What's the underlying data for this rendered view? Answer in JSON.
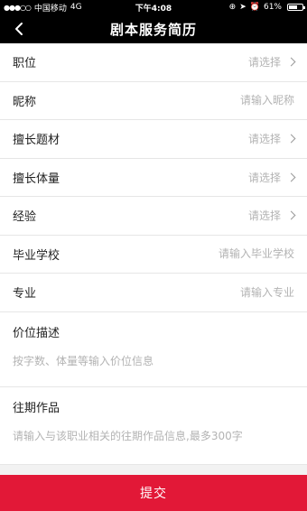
{
  "status_bar": {
    "signal": "●●●○○",
    "carrier": "中国移动",
    "network": "4G",
    "time": "下午4:08",
    "battery": "61%",
    "battery_level": 0.61
  },
  "nav": {
    "back_icon": "chevron-left-icon",
    "title": "剧本服务简历"
  },
  "form": {
    "position": {
      "label": "职位",
      "placeholder": "请选择"
    },
    "nickname": {
      "label": "昵称",
      "placeholder": "请输入昵称"
    },
    "theme": {
      "label": "擅长题材",
      "placeholder": "请选择"
    },
    "volume": {
      "label": "擅长体量",
      "placeholder": "请选择"
    },
    "experience": {
      "label": "经验",
      "placeholder": "请选择"
    },
    "school": {
      "label": "毕业学校",
      "placeholder": "请输入毕业学校"
    },
    "major": {
      "label": "专业",
      "placeholder": "请输入专业"
    },
    "price": {
      "label": "价位描述",
      "placeholder": "按字数、体量等输入价位信息"
    },
    "works": {
      "label": "往期作品",
      "placeholder": "请输入与该职业相关的往期作品信息,最多300字"
    }
  },
  "submit_label": "提交",
  "colors": {
    "accent": "#e21837",
    "nav_bg": "#000000"
  }
}
